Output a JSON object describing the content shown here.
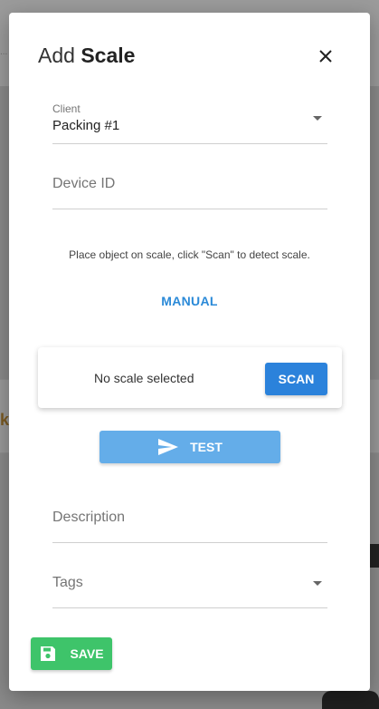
{
  "background": {
    "top_fragment": "...",
    "mid_fragment": "k"
  },
  "dialog": {
    "title_prefix": "Add",
    "title_emphasis": "Scale",
    "close_icon": "close-icon",
    "client": {
      "label": "Client",
      "value": "Packing #1"
    },
    "device_id": {
      "placeholder": "Device ID"
    },
    "hint": "Place object on scale, click \"Scan\" to detect scale.",
    "manual_label": "MANUAL",
    "scan_card": {
      "status": "No scale selected",
      "scan_label": "SCAN"
    },
    "test_label": "TEST",
    "test_icon": "send-icon",
    "description": {
      "placeholder": "Description"
    },
    "tags": {
      "placeholder": "Tags"
    },
    "save_label": "SAVE",
    "save_icon": "floppy-disk-icon"
  },
  "colors": {
    "primary": "#2b82db",
    "test": "#64ade9",
    "save": "#3ec46a",
    "link": "#2b8ad8"
  }
}
